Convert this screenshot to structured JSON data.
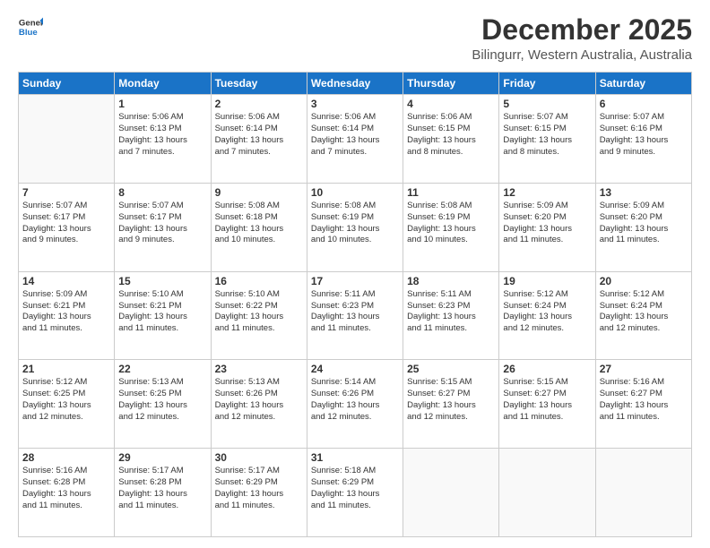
{
  "logo": {
    "line1": "General",
    "line2": "Blue"
  },
  "title": "December 2025",
  "subtitle": "Bilingurr, Western Australia, Australia",
  "weekdays": [
    "Sunday",
    "Monday",
    "Tuesday",
    "Wednesday",
    "Thursday",
    "Friday",
    "Saturday"
  ],
  "weeks": [
    [
      {
        "day": "",
        "info": ""
      },
      {
        "day": "1",
        "info": "Sunrise: 5:06 AM\nSunset: 6:13 PM\nDaylight: 13 hours\nand 7 minutes."
      },
      {
        "day": "2",
        "info": "Sunrise: 5:06 AM\nSunset: 6:14 PM\nDaylight: 13 hours\nand 7 minutes."
      },
      {
        "day": "3",
        "info": "Sunrise: 5:06 AM\nSunset: 6:14 PM\nDaylight: 13 hours\nand 7 minutes."
      },
      {
        "day": "4",
        "info": "Sunrise: 5:06 AM\nSunset: 6:15 PM\nDaylight: 13 hours\nand 8 minutes."
      },
      {
        "day": "5",
        "info": "Sunrise: 5:07 AM\nSunset: 6:15 PM\nDaylight: 13 hours\nand 8 minutes."
      },
      {
        "day": "6",
        "info": "Sunrise: 5:07 AM\nSunset: 6:16 PM\nDaylight: 13 hours\nand 9 minutes."
      }
    ],
    [
      {
        "day": "7",
        "info": "Sunrise: 5:07 AM\nSunset: 6:17 PM\nDaylight: 13 hours\nand 9 minutes."
      },
      {
        "day": "8",
        "info": "Sunrise: 5:07 AM\nSunset: 6:17 PM\nDaylight: 13 hours\nand 9 minutes."
      },
      {
        "day": "9",
        "info": "Sunrise: 5:08 AM\nSunset: 6:18 PM\nDaylight: 13 hours\nand 10 minutes."
      },
      {
        "day": "10",
        "info": "Sunrise: 5:08 AM\nSunset: 6:19 PM\nDaylight: 13 hours\nand 10 minutes."
      },
      {
        "day": "11",
        "info": "Sunrise: 5:08 AM\nSunset: 6:19 PM\nDaylight: 13 hours\nand 10 minutes."
      },
      {
        "day": "12",
        "info": "Sunrise: 5:09 AM\nSunset: 6:20 PM\nDaylight: 13 hours\nand 11 minutes."
      },
      {
        "day": "13",
        "info": "Sunrise: 5:09 AM\nSunset: 6:20 PM\nDaylight: 13 hours\nand 11 minutes."
      }
    ],
    [
      {
        "day": "14",
        "info": "Sunrise: 5:09 AM\nSunset: 6:21 PM\nDaylight: 13 hours\nand 11 minutes."
      },
      {
        "day": "15",
        "info": "Sunrise: 5:10 AM\nSunset: 6:21 PM\nDaylight: 13 hours\nand 11 minutes."
      },
      {
        "day": "16",
        "info": "Sunrise: 5:10 AM\nSunset: 6:22 PM\nDaylight: 13 hours\nand 11 minutes."
      },
      {
        "day": "17",
        "info": "Sunrise: 5:11 AM\nSunset: 6:23 PM\nDaylight: 13 hours\nand 11 minutes."
      },
      {
        "day": "18",
        "info": "Sunrise: 5:11 AM\nSunset: 6:23 PM\nDaylight: 13 hours\nand 11 minutes."
      },
      {
        "day": "19",
        "info": "Sunrise: 5:12 AM\nSunset: 6:24 PM\nDaylight: 13 hours\nand 12 minutes."
      },
      {
        "day": "20",
        "info": "Sunrise: 5:12 AM\nSunset: 6:24 PM\nDaylight: 13 hours\nand 12 minutes."
      }
    ],
    [
      {
        "day": "21",
        "info": "Sunrise: 5:12 AM\nSunset: 6:25 PM\nDaylight: 13 hours\nand 12 minutes."
      },
      {
        "day": "22",
        "info": "Sunrise: 5:13 AM\nSunset: 6:25 PM\nDaylight: 13 hours\nand 12 minutes."
      },
      {
        "day": "23",
        "info": "Sunrise: 5:13 AM\nSunset: 6:26 PM\nDaylight: 13 hours\nand 12 minutes."
      },
      {
        "day": "24",
        "info": "Sunrise: 5:14 AM\nSunset: 6:26 PM\nDaylight: 13 hours\nand 12 minutes."
      },
      {
        "day": "25",
        "info": "Sunrise: 5:15 AM\nSunset: 6:27 PM\nDaylight: 13 hours\nand 12 minutes."
      },
      {
        "day": "26",
        "info": "Sunrise: 5:15 AM\nSunset: 6:27 PM\nDaylight: 13 hours\nand 11 minutes."
      },
      {
        "day": "27",
        "info": "Sunrise: 5:16 AM\nSunset: 6:27 PM\nDaylight: 13 hours\nand 11 minutes."
      }
    ],
    [
      {
        "day": "28",
        "info": "Sunrise: 5:16 AM\nSunset: 6:28 PM\nDaylight: 13 hours\nand 11 minutes."
      },
      {
        "day": "29",
        "info": "Sunrise: 5:17 AM\nSunset: 6:28 PM\nDaylight: 13 hours\nand 11 minutes."
      },
      {
        "day": "30",
        "info": "Sunrise: 5:17 AM\nSunset: 6:29 PM\nDaylight: 13 hours\nand 11 minutes."
      },
      {
        "day": "31",
        "info": "Sunrise: 5:18 AM\nSunset: 6:29 PM\nDaylight: 13 hours\nand 11 minutes."
      },
      {
        "day": "",
        "info": ""
      },
      {
        "day": "",
        "info": ""
      },
      {
        "day": "",
        "info": ""
      }
    ]
  ]
}
